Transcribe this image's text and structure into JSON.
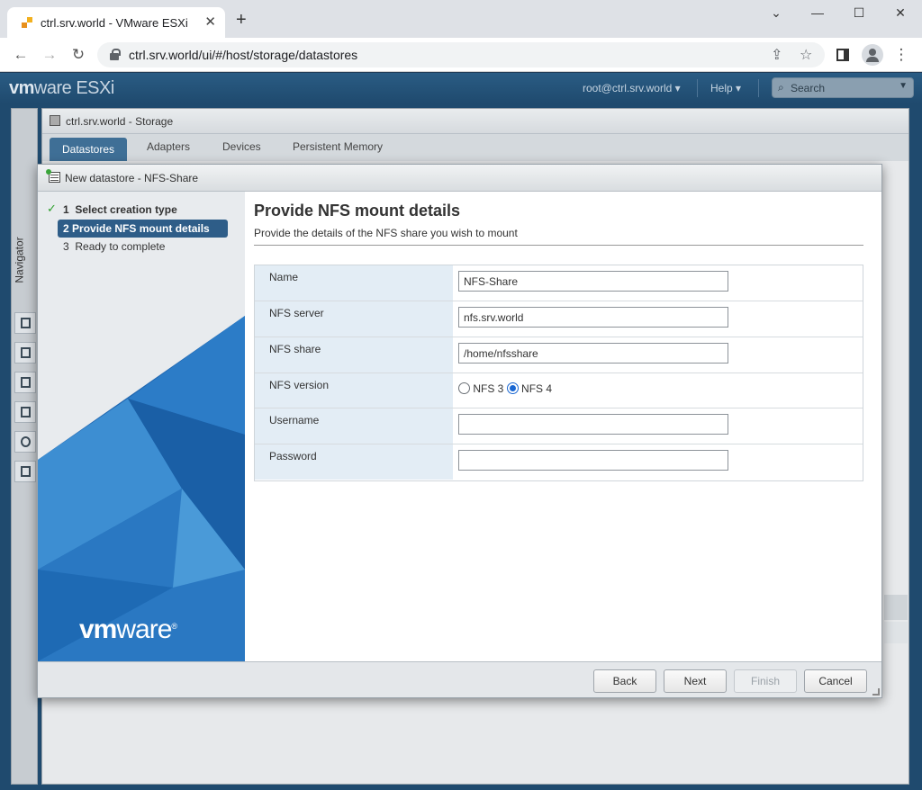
{
  "browser": {
    "tab_title": "ctrl.srv.world - VMware ESXi",
    "url": "ctrl.srv.world/ui/#/host/storage/datastores"
  },
  "esxi": {
    "logo_vm": "vm",
    "logo_rest": "ware",
    "logo_product": "ESXi",
    "user": "root@ctrl.srv.world",
    "help": "Help",
    "search_placeholder": "Search",
    "navigator_label": "Navigator",
    "panel_title": "ctrl.srv.world - Storage",
    "tabs": [
      "Datastores",
      "Adapters",
      "Devices",
      "Persistent Memory"
    ]
  },
  "dialog": {
    "title": "New datastore - NFS-Share",
    "steps": [
      {
        "num": "1",
        "label": "Select creation type",
        "state": "done"
      },
      {
        "num": "2",
        "label": "Provide NFS mount details",
        "state": "active"
      },
      {
        "num": "3",
        "label": "Ready to complete",
        "state": "pending"
      }
    ],
    "brand_vm": "vm",
    "brand_rest": "ware",
    "brand_reg": "®",
    "heading": "Provide NFS mount details",
    "subheading": "Provide the details of the NFS share you wish to mount",
    "fields": {
      "name": {
        "label": "Name",
        "value": "NFS-Share"
      },
      "server": {
        "label": "NFS server",
        "value": "nfs.srv.world"
      },
      "share": {
        "label": "NFS share",
        "value": "/home/nfsshare"
      },
      "version": {
        "label": "NFS version",
        "options": [
          "NFS 3",
          "NFS 4"
        ],
        "selected": "NFS 4"
      },
      "username": {
        "label": "Username",
        "value": ""
      },
      "password": {
        "label": "Password",
        "value": ""
      }
    },
    "buttons": {
      "back": "Back",
      "next": "Next",
      "finish": "Finish",
      "cancel": "Cancel"
    }
  },
  "colors": {
    "header_blue": "#1f4a6e",
    "active_step": "#2e5d88",
    "label_cell": "#e3edf5",
    "check_green": "#2ea02e"
  }
}
